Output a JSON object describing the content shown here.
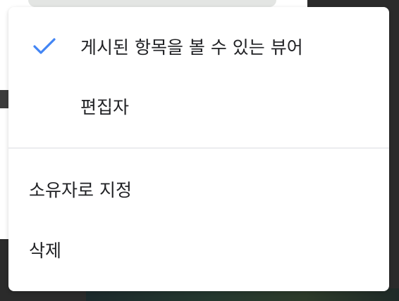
{
  "menu": {
    "items": [
      {
        "label": "게시된 항목을 볼 수 있는 뷰어",
        "checked": true
      },
      {
        "label": "편집자",
        "checked": false
      }
    ],
    "actions": [
      {
        "label": "소유자로 지정"
      },
      {
        "label": "삭제"
      }
    ],
    "check_icon": "checkmark-icon",
    "check_color": "#4285f4"
  }
}
